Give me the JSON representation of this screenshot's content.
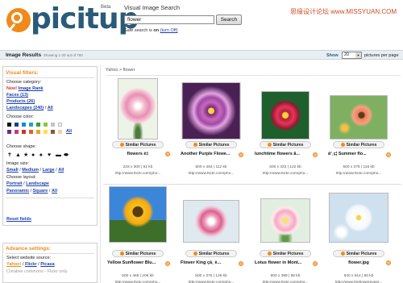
{
  "brand": {
    "logo": "picitup",
    "beta": "Beta"
  },
  "search": {
    "label": "Visual Image Search",
    "value": "flower",
    "button": "Search",
    "safe_prefix": "Safe search is ",
    "safe_state": "on",
    "safe_toggle": "(turn Off)"
  },
  "watermark": "思缘设计论坛 www.MISSYUAN.COM",
  "results_bar": {
    "title": "Image Results",
    "showing": "Showing 1-20 out of 750",
    "show_label": "Show",
    "per_page": "20",
    "per_page_suffix": "pictures per page"
  },
  "filters": {
    "title": "Visual filters:",
    "category_label": "Choose category:",
    "new_label": "New!",
    "image_rank": "Image Rank",
    "faces": "Faces (13)",
    "products": "Products (26)",
    "landscapes": "Landscapes (240)",
    "all": "All",
    "color_label": "Choose color:",
    "colors": [
      "#111111",
      "#1b3f8f",
      "#0a8bd6",
      "#22a3c5",
      "#29a838",
      "#8cc63f",
      "#c4c4c4",
      "#f0f0f0",
      "#6a2c8f",
      "#c23b8a",
      "#d32f2f",
      "#e65c28",
      "#f3a31b",
      "#ffe04a",
      "#8d5a2b",
      "#f2d2a9"
    ],
    "shape_label": "Choose shape:",
    "shapes": [
      "✝",
      "▲",
      "★",
      "●",
      "♠",
      "♥",
      "▬",
      "⬬"
    ],
    "size_label": "Image size:",
    "sizes": [
      "Small",
      "Medium",
      "Large",
      "All"
    ],
    "layout_label": "Choose layout:",
    "layouts_row1": [
      "Portrait",
      "Landscape"
    ],
    "layouts_row2": [
      "Panoramic",
      "Square",
      "All"
    ],
    "reset": "Reset fields"
  },
  "advanced": {
    "title": "Advance settings:",
    "source_label": "Select website source:",
    "sources": [
      "Yahoo!",
      "Flickr",
      "Picasa"
    ],
    "creative": "Creative commons - Flickr only"
  },
  "breadcrumb": "Yahoo > flower",
  "similar_label": "Similar Pictures",
  "results": [
    {
      "caption": "flowers è‡",
      "meta": "233 x 300 | 61 kb",
      "source": "http://www.flickr.com/pho..."
    },
    {
      "caption": "Another Purple Flowe...",
      "meta": "500 x 484 | 112 kb",
      "source": "http://www.flickr.com/pho..."
    },
    {
      "caption": "lunchtime flowers â...",
      "meta": "500 x 333 | 122 kb",
      "source": "http://www.flickr.com/pho..."
    },
    {
      "caption": "å¹¸ç¦ Summer flo...",
      "meta": "500 x 375 | 116 kb",
      "source": "http://www.flickr.com/pho..."
    },
    {
      "caption": "Yellow Sunflower Blu...",
      "meta": "500 x 465 | 206 kb",
      "source": "http://www.flickr.com/pho..."
    },
    {
      "caption": "Flower King çä¸ è...",
      "meta": "500 x 375 | 126 kb",
      "source": "http://www.flickr.com/pho..."
    },
    {
      "caption": "Lotus flower in Mont...",
      "meta": "500 x 389 | 98 kb",
      "source": "http://www.flickr.com/pho..."
    },
    {
      "caption": "flower.jpg",
      "meta": "640 x 614 | 60 kb",
      "source": "http://www.theflowerexper..."
    }
  ]
}
